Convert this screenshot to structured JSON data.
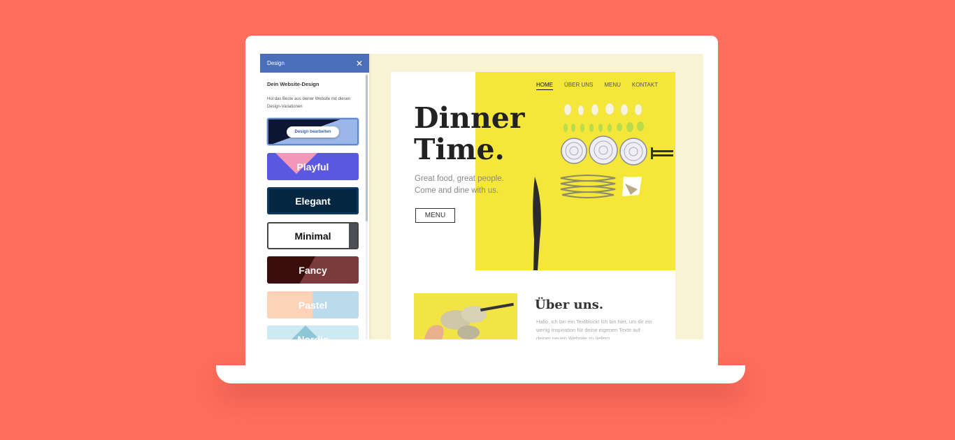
{
  "panel": {
    "header_title": "Design",
    "section_title": "Dein Website-Design",
    "description": "Hol das Beste aus deiner Website mit diesen Design-Variationen",
    "current_button": "Design bearbeiten",
    "styles": [
      "Playful",
      "Elegant",
      "Minimal",
      "Fancy",
      "Pastel",
      "Nordic"
    ]
  },
  "site": {
    "nav": [
      "HOME",
      "ÜBER UNS",
      "MENU",
      "KONTAKT"
    ],
    "hero_title": "Dinner\nTime.",
    "hero_subtitle": "Great food, great people. Come and dine with us.",
    "menu_button": "MENU",
    "about_title": "Über uns.",
    "about_text": "Hallo, ich bin ein Textblock! Ich bin hier, um dir ein wenig Inspiration für deine eigenen Texte auf deiner neuen Website zu liefern."
  },
  "colors": {
    "background": "#ff6d5c",
    "panel_header": "#4a6fb8",
    "hero_yellow": "#f5e63a"
  }
}
